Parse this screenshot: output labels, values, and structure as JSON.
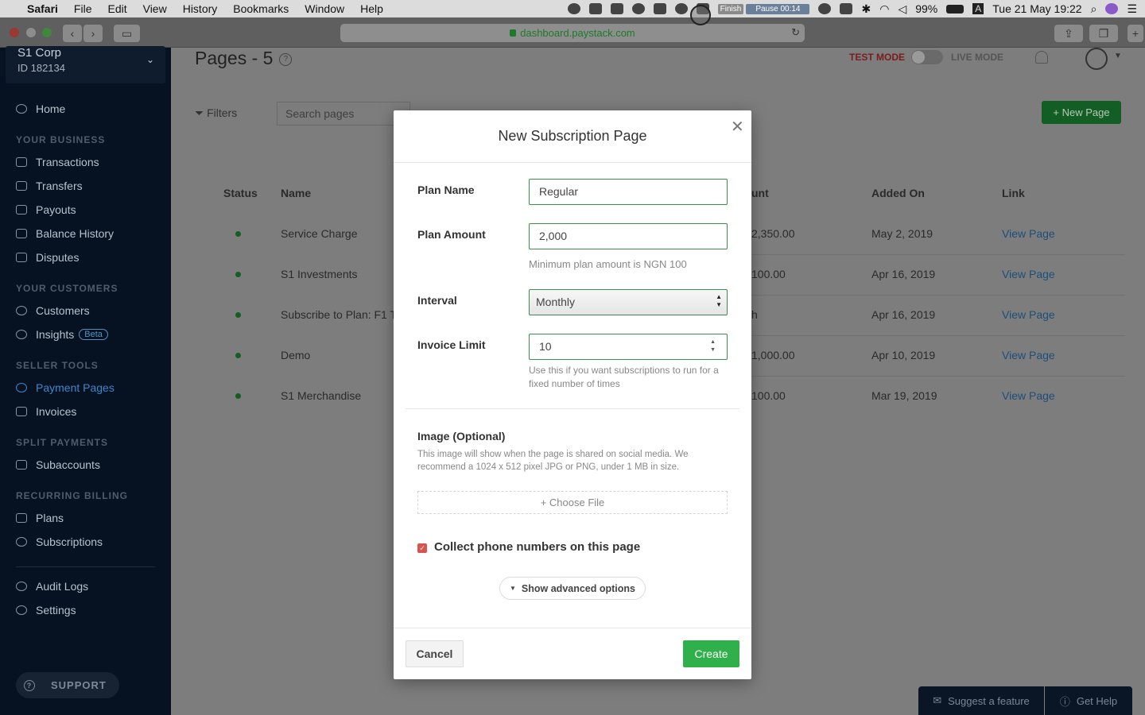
{
  "menubar": {
    "app": "Safari",
    "items": [
      "File",
      "Edit",
      "View",
      "History",
      "Bookmarks",
      "Window",
      "Help"
    ],
    "recorder_finish": "Finish",
    "recorder_pause": "Pause 00:14",
    "battery": "99%",
    "input_source": "A",
    "datetime": "Tue 21 May  19:22"
  },
  "browser": {
    "url": "dashboard.paystack.com"
  },
  "sidebar": {
    "business_name": "S1 Corp",
    "business_id": "ID 182134",
    "home": "Home",
    "sections": {
      "business": "YOUR BUSINESS",
      "customers": "YOUR CUSTOMERS",
      "seller": "SELLER TOOLS",
      "split": "SPLIT PAYMENTS",
      "recurring": "RECURRING BILLING"
    },
    "items": {
      "transactions": "Transactions",
      "transfers": "Transfers",
      "payouts": "Payouts",
      "balance_history": "Balance History",
      "disputes": "Disputes",
      "customers": "Customers",
      "insights": "Insights",
      "insights_badge": "Beta",
      "payment_pages": "Payment Pages",
      "invoices": "Invoices",
      "subaccounts": "Subaccounts",
      "plans": "Plans",
      "subscriptions": "Subscriptions",
      "audit_logs": "Audit Logs",
      "settings": "Settings"
    },
    "support": "SUPPORT"
  },
  "main": {
    "title": "Pages - 5",
    "test_mode": "TEST MODE",
    "live_mode": "LIVE MODE",
    "filters": "Filters",
    "search_placeholder": "Search pages",
    "new_page": "+ New Page",
    "columns": {
      "status": "Status",
      "name": "Name",
      "amount": "unt",
      "added_on": "Added On",
      "link": "Link"
    },
    "rows": [
      {
        "name": "Service Charge",
        "amount": "2,350.00",
        "added": "May 2, 2019",
        "link": "View Page"
      },
      {
        "name": "S1 Investments",
        "amount": "100.00",
        "added": "Apr 16, 2019",
        "link": "View Page"
      },
      {
        "name": "Subscribe to Plan: F1 T",
        "amount": "h",
        "added": "Apr 16, 2019",
        "link": "View Page"
      },
      {
        "name": "Demo",
        "amount": "1,000.00",
        "added": "Apr 10, 2019",
        "link": "View Page"
      },
      {
        "name": "S1 Merchandise",
        "amount": "100.00",
        "added": "Mar 19, 2019",
        "link": "View Page"
      }
    ],
    "suggest": "Suggest a feature",
    "get_help": "Get Help"
  },
  "modal": {
    "title": "New Subscription Page",
    "plan_name_label": "Plan Name",
    "plan_name_value": "Regular",
    "plan_amount_label": "Plan Amount",
    "plan_amount_value": "2,000",
    "plan_amount_help": "Minimum plan amount is NGN 100",
    "interval_label": "Interval",
    "interval_value": "Monthly",
    "invoice_limit_label": "Invoice Limit",
    "invoice_limit_value": "10",
    "invoice_limit_help": "Use this if you want subscriptions to run for a fixed number of times",
    "image_title": "Image (Optional)",
    "image_desc": "This image will show when the page is shared on social media. We recommend a 1024 x 512 pixel JPG or PNG, under 1 MB in size.",
    "choose_file": "+ Choose File",
    "collect_phone_label": "Collect phone numbers on this page",
    "collect_phone_checked": true,
    "advanced": "Show advanced options",
    "cancel": "Cancel",
    "create": "Create"
  },
  "colors": {
    "accent_green": "#2fb04a",
    "sidebar_bg": "#061221",
    "active_blue": "#3e86cc",
    "checkbox_red": "#d9534f"
  }
}
